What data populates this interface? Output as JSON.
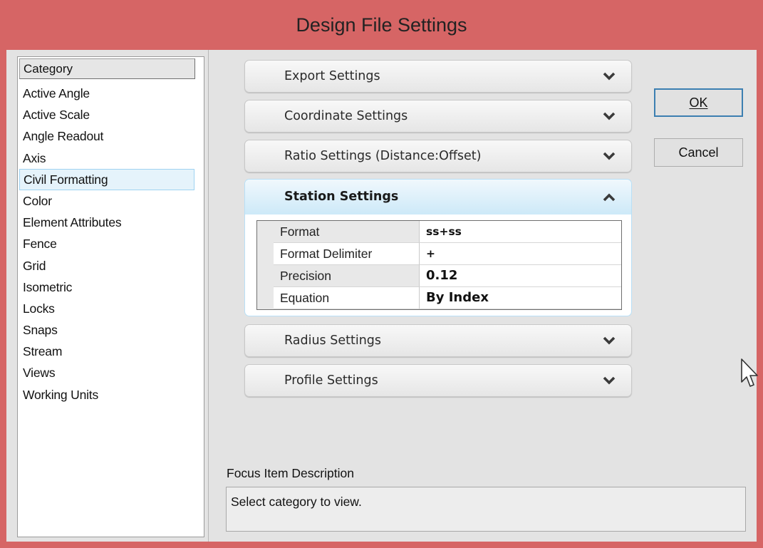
{
  "window": {
    "title": "Design File Settings"
  },
  "category": {
    "header": "Category",
    "items": [
      "Active Angle",
      "Active Scale",
      "Angle Readout",
      "Axis",
      "Civil Formatting",
      "Color",
      "Element Attributes",
      "Fence",
      "Grid",
      "Isometric",
      "Locks",
      "Snaps",
      "Stream",
      "Views",
      "Working Units"
    ],
    "selected": "Civil Formatting"
  },
  "sections": {
    "export": "Export Settings",
    "coordinate": "Coordinate Settings",
    "ratio": "Ratio Settings (Distance:Offset)",
    "station": "Station Settings",
    "radius": "Radius Settings",
    "profile": "Profile Settings"
  },
  "station_props": {
    "rows": [
      {
        "name": "Format",
        "value": "ss+ss"
      },
      {
        "name": "Format Delimiter",
        "value": "+"
      },
      {
        "name": "Precision",
        "value": "0.12"
      },
      {
        "name": "Equation",
        "value": "By Index"
      }
    ]
  },
  "buttons": {
    "ok": "OK",
    "cancel": "Cancel"
  },
  "focus": {
    "label": "Focus Item Description",
    "text": "Select category to view."
  },
  "icons": {
    "expand": "chevron-down-icon",
    "collapse": "chevron-up-icon",
    "cursor": "mouse-pointer-icon"
  },
  "colors": {
    "titlebar": "#d66565",
    "selection": "#e5f3fb",
    "default_button_border": "#3c7fb1"
  }
}
